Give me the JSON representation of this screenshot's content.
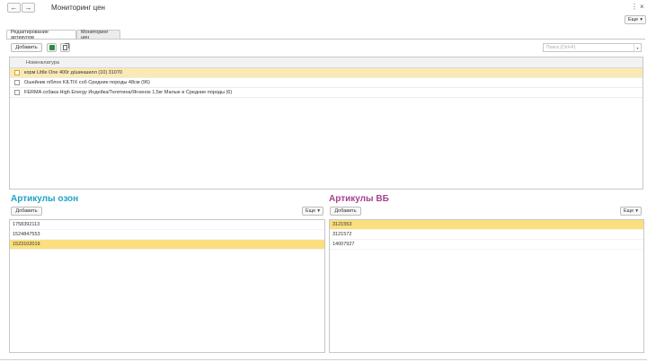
{
  "window": {
    "title": "Мониторинг цен",
    "back_icon": "←",
    "forward_icon": "→",
    "more_icon": "⋮",
    "close_icon": "×"
  },
  "top_more": {
    "label": "Еще",
    "arrow": "▾"
  },
  "tabs": [
    {
      "label": "Редактирование артикулов",
      "active": true
    },
    {
      "label": "Мониторинг цен",
      "active": false
    }
  ],
  "toolbar": {
    "add_label": "Добавить",
    "search_placeholder": "Поиск (Ctrl+F)",
    "search_dropdown": "▾"
  },
  "nomenclature": {
    "header": "Номенклатура",
    "rows": [
      {
        "text": "корм Little One 400г д/шиншилл (10)  31070",
        "selected": true
      },
      {
        "text": "Ошейник п/блох  KILTIX  соб Средние породы 48см (96)",
        "selected": false
      },
      {
        "text": "FERMA собака High Energy Индейка/Телятина/Ягненок 1,5кг Малые и Средние породы (6)",
        "selected": false
      }
    ]
  },
  "ozon": {
    "title": "Артикулы озон",
    "title_color": "#1fa3c6",
    "add_label": "Добавить",
    "more_label": "Еще",
    "more_arrow": "▾",
    "rows": [
      {
        "value": "1758392113",
        "selected": false
      },
      {
        "value": "1524847553",
        "selected": false
      },
      {
        "value": "1523102019",
        "selected": true
      }
    ]
  },
  "wb": {
    "title": "Артикулы ВБ",
    "title_color": "#a7428f",
    "add_label": "Добавить",
    "more_label": "Еще",
    "more_arrow": "▾",
    "rows": [
      {
        "value": "3121553",
        "selected": true
      },
      {
        "value": "3121572",
        "selected": false
      },
      {
        "value": "14007927",
        "selected": false
      }
    ]
  },
  "colors": {
    "selected_row": "#fbe9b4",
    "selected_list_row": "#fbdf7e"
  }
}
